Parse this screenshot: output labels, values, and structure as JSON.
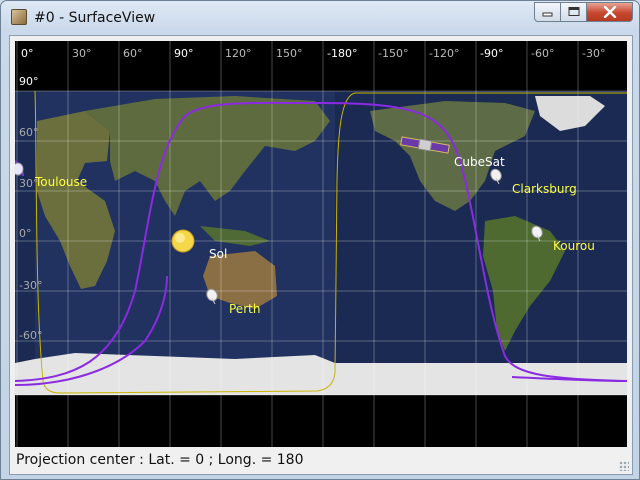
{
  "window": {
    "title": "#0 - SurfaceView"
  },
  "map": {
    "longitude_labels": [
      "0°",
      "30°",
      "60°",
      "90°",
      "120°",
      "150°",
      "-180°",
      "-150°",
      "-120°",
      "-90°",
      "-60°",
      "-30°"
    ],
    "latitude_labels": [
      "90°",
      "60°",
      "30°",
      "0°",
      "-30°",
      "-60°"
    ],
    "ground_stations": [
      {
        "name": "Toulouse",
        "lat": 43.6,
        "lon": 1.4
      },
      {
        "name": "Clarksburg",
        "lat": 39.2,
        "lon": -77.3
      },
      {
        "name": "Kourou",
        "lat": 5.2,
        "lon": -52.8
      },
      {
        "name": "Perth",
        "lat": -31.9,
        "lon": 115.9
      }
    ],
    "spacecraft": {
      "name": "CubeSat"
    },
    "sun": {
      "name": "Sol"
    },
    "colors": {
      "ocean": "#1b2a52",
      "land": "#5b6a3c",
      "ice": "#e4e4e4",
      "ground_track": "#8a2be2",
      "station_label": "#ffff40",
      "object_label": "#ffffff"
    }
  },
  "status": {
    "text": "Projection center : Lat. = 0 ; Long. = 180"
  }
}
